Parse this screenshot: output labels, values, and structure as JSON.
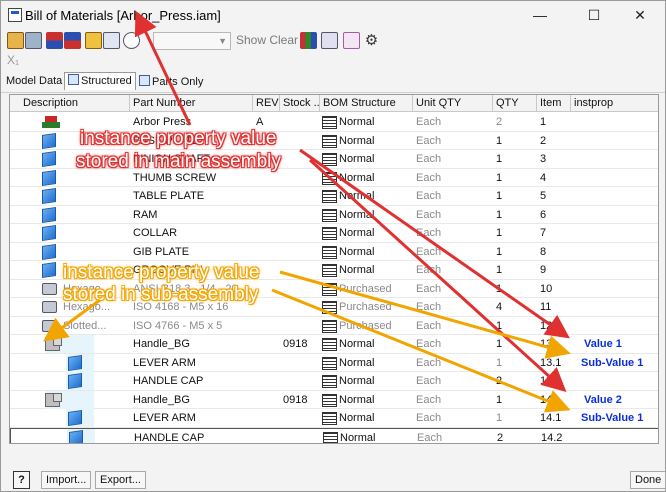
{
  "window": {
    "title": "Bill of Materials [Arbor_Press.iam]",
    "minimize": "—",
    "maximize": "☐",
    "close": "✕"
  },
  "toolbar": {
    "show_clear": "Show Clear",
    "combo_value": ""
  },
  "view_tabs": [
    {
      "label": "Model Data"
    },
    {
      "label": "Structured"
    },
    {
      "label": "Parts Only"
    }
  ],
  "columns": [
    "Description",
    "Part Number",
    "REV",
    "Stock ...",
    "BOM Structure",
    "Unit QTY",
    "QTY",
    "Item",
    "instprop"
  ],
  "rows": [
    {
      "description": "",
      "part_number": "Arbor Press",
      "rev": "A",
      "stock": "",
      "bom": "Normal",
      "unit_qty": "Each",
      "qty": "2",
      "item": "1",
      "instprop": "",
      "icon": "top-assembly-icon"
    },
    {
      "description": "",
      "part_number": "BASE PLATE",
      "rev": "",
      "stock": "",
      "bom": "Normal",
      "unit_qty": "Each",
      "qty": "1",
      "item": "2",
      "instprop": "",
      "icon": "part-icon"
    },
    {
      "description": "",
      "part_number": "PINION SHAFT",
      "rev": "",
      "stock": "",
      "bom": "Normal",
      "unit_qty": "Each",
      "qty": "1",
      "item": "3",
      "instprop": "",
      "icon": "part-icon"
    },
    {
      "description": "",
      "part_number": "THUMB SCREW",
      "rev": "",
      "stock": "",
      "bom": "Normal",
      "unit_qty": "Each",
      "qty": "1",
      "item": "4",
      "instprop": "",
      "icon": "part-icon"
    },
    {
      "description": "",
      "part_number": "TABLE PLATE",
      "rev": "",
      "stock": "",
      "bom": "Normal",
      "unit_qty": "Each",
      "qty": "1",
      "item": "5",
      "instprop": "",
      "icon": "part-icon"
    },
    {
      "description": "",
      "part_number": "RAM",
      "rev": "",
      "stock": "",
      "bom": "Normal",
      "unit_qty": "Each",
      "qty": "1",
      "item": "6",
      "instprop": "",
      "icon": "part-icon"
    },
    {
      "description": "",
      "part_number": "COLLAR",
      "rev": "",
      "stock": "",
      "bom": "Normal",
      "unit_qty": "Each",
      "qty": "1",
      "item": "7",
      "instprop": "",
      "icon": "part-icon"
    },
    {
      "description": "",
      "part_number": "GIB PLATE",
      "rev": "",
      "stock": "",
      "bom": "Normal",
      "unit_qty": "Each",
      "qty": "1",
      "item": "8",
      "instprop": "",
      "icon": "part-icon"
    },
    {
      "description": "",
      "part_number": "GROOVE PIN",
      "rev": "",
      "stock": "",
      "bom": "Normal",
      "unit_qty": "Each",
      "qty": "1",
      "item": "9",
      "instprop": "",
      "icon": "part-icon"
    },
    {
      "description": "Hexago...",
      "part_number": "ANSI B18.3 - 1/4 - 20",
      "rev": "",
      "stock": "",
      "bom": "Purchased",
      "unit_qty": "Each",
      "qty": "1",
      "item": "10",
      "instprop": "",
      "icon": "standard-part-icon"
    },
    {
      "description": "Hexago...",
      "part_number": "ISO 4168 - M5 x 16",
      "rev": "",
      "stock": "",
      "bom": "Purchased",
      "unit_qty": "Each",
      "qty": "4",
      "item": "11",
      "instprop": "",
      "icon": "standard-part-icon"
    },
    {
      "description": "Slotted...",
      "part_number": "ISO 4766 - M5 x 5",
      "rev": "",
      "stock": "",
      "bom": "Purchased",
      "unit_qty": "Each",
      "qty": "1",
      "item": "12",
      "instprop": "",
      "icon": "standard-part-icon"
    },
    {
      "description": "",
      "part_number": "Handle_BG",
      "rev": "",
      "stock": "0918",
      "bom": "Normal",
      "unit_qty": "Each",
      "qty": "1",
      "item": "13",
      "instprop": "Value 1",
      "icon": "sub-assembly-icon"
    },
    {
      "description": "",
      "part_number": "LEVER ARM",
      "rev": "",
      "stock": "",
      "bom": "Normal",
      "unit_qty": "Each",
      "qty": "1",
      "item": "13.1",
      "instprop": "Sub-Value 1",
      "icon": "part-icon"
    },
    {
      "description": "",
      "part_number": "HANDLE CAP",
      "rev": "",
      "stock": "",
      "bom": "Normal",
      "unit_qty": "Each",
      "qty": "2",
      "item": "13.2",
      "instprop": "",
      "icon": "part-icon"
    },
    {
      "description": "",
      "part_number": "Handle_BG",
      "rev": "",
      "stock": "0918",
      "bom": "Normal",
      "unit_qty": "Each",
      "qty": "1",
      "item": "14",
      "instprop": "Value 2",
      "icon": "sub-assembly-icon"
    },
    {
      "description": "",
      "part_number": "LEVER ARM",
      "rev": "",
      "stock": "",
      "bom": "Normal",
      "unit_qty": "Each",
      "qty": "1",
      "item": "14.1",
      "instprop": "Sub-Value 1",
      "icon": "part-icon"
    },
    {
      "description": "",
      "part_number": "HANDLE CAP",
      "rev": "",
      "stock": "",
      "bom": "Normal",
      "unit_qty": "Each",
      "qty": "2",
      "item": "14.2",
      "instprop": "",
      "icon": "part-icon"
    }
  ],
  "annotations": {
    "main_line1": "instance property value",
    "main_line2": "stored in main assembly",
    "sub_line1": "instance property value",
    "sub_line2": "stored in sub-assembly",
    "red_color": "#e03030",
    "orange_color": "#f2a500"
  },
  "footer": {
    "help": "?",
    "import": "Import...",
    "export": "Export...",
    "done": "Done"
  },
  "colors": {
    "value_label": "#0a2fd8",
    "highlight": "#e6f4fb"
  }
}
